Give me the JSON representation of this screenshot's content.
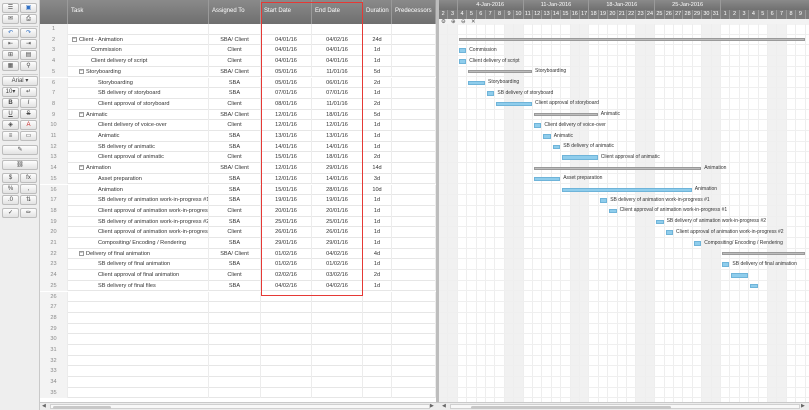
{
  "toolbar": {
    "font_family_value": "Arial",
    "font_size_value": "10",
    "buttons": [
      "undo",
      "redo",
      "bold",
      "italic",
      "underline",
      "strikethrough"
    ],
    "bold_label": "B",
    "italic_label": "I",
    "underline_label": "U",
    "strike_label": "S",
    "text_color_label": "A",
    "currency_label": "$",
    "percent_label": "%",
    "comma_label": ",",
    "formula_label": "fx",
    "decimal_label": ".0"
  },
  "grid": {
    "columns": [
      "",
      "Task",
      "Assigned To",
      "Start Date",
      "End Date",
      "Duration",
      "Predecessors"
    ],
    "rows": [
      {
        "num": "1",
        "task": "",
        "assigned": "",
        "start": "",
        "end": "",
        "duration": "",
        "level": 0,
        "summary": false
      },
      {
        "num": "2",
        "task": "Client - Animation",
        "assigned": "SBA/ Client",
        "start": "04/01/16",
        "end": "04/02/16",
        "duration": "24d",
        "level": 0,
        "summary": true
      },
      {
        "num": "3",
        "task": "Commission",
        "assigned": "Client",
        "start": "04/01/16",
        "end": "04/01/16",
        "duration": "1d",
        "level": 1,
        "summary": false
      },
      {
        "num": "4",
        "task": "Client delivery of script",
        "assigned": "Client",
        "start": "04/01/16",
        "end": "04/01/16",
        "duration": "1d",
        "level": 1,
        "summary": false
      },
      {
        "num": "5",
        "task": "Storyboarding",
        "assigned": "SBA/ Client",
        "start": "05/01/16",
        "end": "11/01/16",
        "duration": "5d",
        "level": 1,
        "summary": true
      },
      {
        "num": "6",
        "task": "Storyboarding",
        "assigned": "SBA",
        "start": "05/01/16",
        "end": "06/01/16",
        "duration": "2d",
        "level": 2,
        "summary": false
      },
      {
        "num": "7",
        "task": "SB delivery of storyboard",
        "assigned": "SBA",
        "start": "07/01/16",
        "end": "07/01/16",
        "duration": "1d",
        "level": 2,
        "summary": false
      },
      {
        "num": "8",
        "task": "Client approval of storyboard",
        "assigned": "Client",
        "start": "08/01/16",
        "end": "11/01/16",
        "duration": "2d",
        "level": 2,
        "summary": false
      },
      {
        "num": "9",
        "task": "Animatic",
        "assigned": "SBA/ Client",
        "start": "12/01/16",
        "end": "18/01/16",
        "duration": "5d",
        "level": 1,
        "summary": true
      },
      {
        "num": "10",
        "task": "Client delivery of voice-over",
        "assigned": "Client",
        "start": "12/01/16",
        "end": "12/01/16",
        "duration": "1d",
        "level": 2,
        "summary": false
      },
      {
        "num": "11",
        "task": "Animatic",
        "assigned": "SBA",
        "start": "13/01/16",
        "end": "13/01/16",
        "duration": "1d",
        "level": 2,
        "summary": false
      },
      {
        "num": "12",
        "task": "SB delivery of animatic",
        "assigned": "SBA",
        "start": "14/01/16",
        "end": "14/01/16",
        "duration": "1d",
        "level": 2,
        "summary": false
      },
      {
        "num": "13",
        "task": "Client approval of animatic",
        "assigned": "Client",
        "start": "15/01/16",
        "end": "18/01/16",
        "duration": "2d",
        "level": 2,
        "summary": false
      },
      {
        "num": "14",
        "task": "Animation",
        "assigned": "SBA/ Client",
        "start": "12/01/16",
        "end": "29/01/16",
        "duration": "14d",
        "level": 1,
        "summary": true
      },
      {
        "num": "15",
        "task": "Asset preparation",
        "assigned": "SBA",
        "start": "12/01/16",
        "end": "14/01/16",
        "duration": "3d",
        "level": 2,
        "summary": false
      },
      {
        "num": "16",
        "task": "Animation",
        "assigned": "SBA",
        "start": "15/01/16",
        "end": "28/01/16",
        "duration": "10d",
        "level": 2,
        "summary": false
      },
      {
        "num": "17",
        "task": "SB delivery of animation work-in-progress #1",
        "assigned": "SBA",
        "start": "19/01/16",
        "end": "19/01/16",
        "duration": "1d",
        "level": 2,
        "summary": false
      },
      {
        "num": "18",
        "task": "Client approval of animation work-in-progress #1",
        "assigned": "Client",
        "start": "20/01/16",
        "end": "20/01/16",
        "duration": "1d",
        "level": 2,
        "summary": false
      },
      {
        "num": "19",
        "task": "SB delivery of animation work-in-progress #2",
        "assigned": "SBA",
        "start": "25/01/16",
        "end": "25/01/16",
        "duration": "1d",
        "level": 2,
        "summary": false
      },
      {
        "num": "20",
        "task": "Client approval of animation work-in-progress #2",
        "assigned": "Client",
        "start": "26/01/16",
        "end": "26/01/16",
        "duration": "1d",
        "level": 2,
        "summary": false
      },
      {
        "num": "21",
        "task": "Compositing/ Encoding / Rendering",
        "assigned": "SBA",
        "start": "29/01/16",
        "end": "29/01/16",
        "duration": "1d",
        "level": 2,
        "summary": false
      },
      {
        "num": "22",
        "task": "Delivery of final animation",
        "assigned": "SBA/ Client",
        "start": "01/02/16",
        "end": "04/02/16",
        "duration": "4d",
        "level": 1,
        "summary": true
      },
      {
        "num": "23",
        "task": "SB delivery of final animation",
        "assigned": "SBA",
        "start": "01/02/16",
        "end": "01/02/16",
        "duration": "1d",
        "level": 2,
        "summary": false
      },
      {
        "num": "24",
        "task": "Client approval of final animation",
        "assigned": "Client",
        "start": "02/02/16",
        "end": "03/02/16",
        "duration": "2d",
        "level": 2,
        "summary": false
      },
      {
        "num": "25",
        "task": "SB delivery of final files",
        "assigned": "SBA",
        "start": "04/02/16",
        "end": "04/02/16",
        "duration": "1d",
        "level": 2,
        "summary": false
      },
      {
        "num": "26",
        "task": "",
        "assigned": "",
        "start": "",
        "end": "",
        "duration": "",
        "level": 0,
        "summary": false
      },
      {
        "num": "27",
        "task": "",
        "assigned": "",
        "start": "",
        "end": "",
        "duration": "",
        "level": 0,
        "summary": false
      },
      {
        "num": "28",
        "task": "",
        "assigned": "",
        "start": "",
        "end": "",
        "duration": "",
        "level": 0,
        "summary": false
      },
      {
        "num": "29",
        "task": "",
        "assigned": "",
        "start": "",
        "end": "",
        "duration": "",
        "level": 0,
        "summary": false
      },
      {
        "num": "30",
        "task": "",
        "assigned": "",
        "start": "",
        "end": "",
        "duration": "",
        "level": 0,
        "summary": false
      },
      {
        "num": "31",
        "task": "",
        "assigned": "",
        "start": "",
        "end": "",
        "duration": "",
        "level": 0,
        "summary": false
      },
      {
        "num": "32",
        "task": "",
        "assigned": "",
        "start": "",
        "end": "",
        "duration": "",
        "level": 0,
        "summary": false
      },
      {
        "num": "33",
        "task": "",
        "assigned": "",
        "start": "",
        "end": "",
        "duration": "",
        "level": 0,
        "summary": false
      },
      {
        "num": "34",
        "task": "",
        "assigned": "",
        "start": "",
        "end": "",
        "duration": "",
        "level": 0,
        "summary": false
      },
      {
        "num": "35",
        "task": "",
        "assigned": "",
        "start": "",
        "end": "",
        "duration": "",
        "level": 0,
        "summary": false
      }
    ]
  },
  "gantt": {
    "weeks": [
      "4-Jan-2016",
      "11-Jan-2016",
      "18-Jan-2016",
      "25-Jan-2016"
    ],
    "days": [
      "2",
      "3",
      "4",
      "5",
      "6",
      "7",
      "8",
      "9",
      "10",
      "11",
      "12",
      "13",
      "14",
      "15",
      "16",
      "17",
      "18",
      "19",
      "20",
      "21",
      "22",
      "23",
      "24",
      "25",
      "26",
      "27",
      "28",
      "29",
      "30",
      "31",
      "1",
      "2",
      "3",
      "4",
      "5",
      "6",
      "7",
      "8",
      "9"
    ],
    "bars": [
      {
        "row": 1,
        "start": 2,
        "end": 39,
        "type": "sum",
        "label": ""
      },
      {
        "row": 2,
        "start": 2,
        "end": 3,
        "type": "task",
        "label": "Commission"
      },
      {
        "row": 3,
        "start": 2,
        "end": 3,
        "type": "task",
        "label": "Client delivery of script"
      },
      {
        "row": 4,
        "start": 3,
        "end": 10,
        "type": "sum",
        "label": "Storyboarding"
      },
      {
        "row": 5,
        "start": 3,
        "end": 5,
        "type": "task",
        "label": "Storyboarding"
      },
      {
        "row": 6,
        "start": 5,
        "end": 6,
        "type": "task",
        "label": "SB delivery of storyboard"
      },
      {
        "row": 7,
        "start": 6,
        "end": 10,
        "type": "task",
        "label": "Client approval of storyboard"
      },
      {
        "row": 8,
        "start": 10,
        "end": 17,
        "type": "sum",
        "label": "Animatic"
      },
      {
        "row": 9,
        "start": 10,
        "end": 11,
        "type": "task",
        "label": "Client delivery of voice-over"
      },
      {
        "row": 10,
        "start": 11,
        "end": 12,
        "type": "task",
        "label": "Animatic"
      },
      {
        "row": 11,
        "start": 12,
        "end": 13,
        "type": "task",
        "label": "SB delivery of animatic"
      },
      {
        "row": 12,
        "start": 13,
        "end": 17,
        "type": "task",
        "label": "Client approval of animatic"
      },
      {
        "row": 13,
        "start": 10,
        "end": 28,
        "type": "sum",
        "label": "Animation"
      },
      {
        "row": 14,
        "start": 10,
        "end": 13,
        "type": "task",
        "label": "Asset preparation"
      },
      {
        "row": 15,
        "start": 13,
        "end": 27,
        "type": "task",
        "label": "Animation"
      },
      {
        "row": 16,
        "start": 17,
        "end": 18,
        "type": "task",
        "label": "SB delivery of animation work-in-progress #1"
      },
      {
        "row": 17,
        "start": 18,
        "end": 19,
        "type": "task",
        "label": "Client approval of animation work-in-progress #1"
      },
      {
        "row": 18,
        "start": 23,
        "end": 24,
        "type": "task",
        "label": "SB delivery of animation work-in-progress #2"
      },
      {
        "row": 19,
        "start": 24,
        "end": 25,
        "type": "task",
        "label": "Client approval of animation work-in-progress #2"
      },
      {
        "row": 20,
        "start": 27,
        "end": 28,
        "type": "task",
        "label": "Compositing/ Encoding / Rendering"
      },
      {
        "row": 21,
        "start": 30,
        "end": 39,
        "type": "sum",
        "label": ""
      },
      {
        "row": 22,
        "start": 30,
        "end": 31,
        "type": "task",
        "label": "SB delivery of final animation"
      },
      {
        "row": 23,
        "start": 31,
        "end": 33,
        "type": "task",
        "label": ""
      },
      {
        "row": 24,
        "start": 33,
        "end": 34,
        "type": "task",
        "label": ""
      }
    ]
  },
  "colors": {
    "header_bg": "#7d7d7d",
    "task_bar": "#8fcdec",
    "summary_bar": "#bdbdbd",
    "highlight_box": "#e53935"
  }
}
